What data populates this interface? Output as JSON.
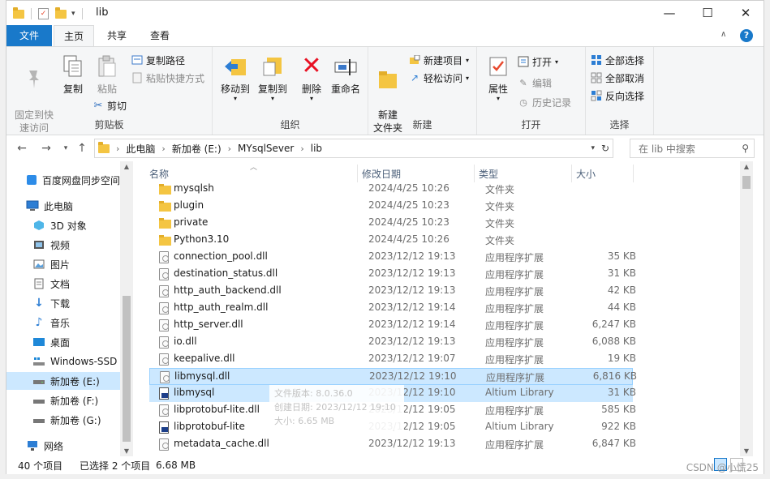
{
  "window": {
    "title": "lib",
    "minimize": "—",
    "maximize": "☐",
    "close": "✕",
    "help": "?"
  },
  "ribbon_tabs": [
    {
      "label": "文件"
    },
    {
      "label": "主页"
    },
    {
      "label": "共享"
    },
    {
      "label": "查看"
    }
  ],
  "ribbon": {
    "clipboard": {
      "label": "剪贴板",
      "pin": "固定到快\n速访问",
      "copy": "复制",
      "paste": "粘贴",
      "copy_path": "复制路径",
      "paste_shortcut": "粘贴快捷方式",
      "cut": "剪切"
    },
    "organize": {
      "label": "组织",
      "move_to": "移动到",
      "copy_to": "复制到",
      "delete": "删除",
      "rename": "重命名"
    },
    "new": {
      "label": "新建",
      "new_folder": "新建\n文件夹",
      "new_item": "新建项目",
      "easy_access": "轻松访问"
    },
    "open": {
      "label": "打开",
      "properties": "属性",
      "open": "打开",
      "edit": "编辑",
      "history": "历史记录"
    },
    "select": {
      "label": "选择",
      "select_all": "全部选择",
      "select_none": "全部取消",
      "invert": "反向选择"
    }
  },
  "address": {
    "crumbs": [
      "此电脑",
      "新加卷 (E:)",
      "MYsqlSever",
      "lib"
    ],
    "search_placeholder": "在 lib 中搜索"
  },
  "nav_items": [
    {
      "label": "百度网盘同步空间"
    },
    {
      "label": "此电脑"
    },
    {
      "label": "3D 对象"
    },
    {
      "label": "视频"
    },
    {
      "label": "图片"
    },
    {
      "label": "文档"
    },
    {
      "label": "下载"
    },
    {
      "label": "音乐"
    },
    {
      "label": "桌面"
    },
    {
      "label": "Windows-SSD"
    },
    {
      "label": "新加卷 (E:)"
    },
    {
      "label": "新加卷 (F:)"
    },
    {
      "label": "新加卷 (G:)"
    },
    {
      "label": "网络"
    }
  ],
  "columns": {
    "name": "名称",
    "date": "修改日期",
    "type": "类型",
    "size": "大小"
  },
  "files": [
    {
      "name": "mysqlsh",
      "date": "2024/4/25 10:26",
      "type": "文件夹",
      "size": "",
      "kind": "folder"
    },
    {
      "name": "plugin",
      "date": "2024/4/25 10:23",
      "type": "文件夹",
      "size": "",
      "kind": "folder"
    },
    {
      "name": "private",
      "date": "2024/4/25 10:23",
      "type": "文件夹",
      "size": "",
      "kind": "folder"
    },
    {
      "name": "Python3.10",
      "date": "2024/4/25 10:26",
      "type": "文件夹",
      "size": "",
      "kind": "folder"
    },
    {
      "name": "connection_pool.dll",
      "date": "2023/12/12 19:13",
      "type": "应用程序扩展",
      "size": "35 KB",
      "kind": "dll"
    },
    {
      "name": "destination_status.dll",
      "date": "2023/12/12 19:13",
      "type": "应用程序扩展",
      "size": "31 KB",
      "kind": "dll"
    },
    {
      "name": "http_auth_backend.dll",
      "date": "2023/12/12 19:13",
      "type": "应用程序扩展",
      "size": "42 KB",
      "kind": "dll"
    },
    {
      "name": "http_auth_realm.dll",
      "date": "2023/12/12 19:14",
      "type": "应用程序扩展",
      "size": "44 KB",
      "kind": "dll"
    },
    {
      "name": "http_server.dll",
      "date": "2023/12/12 19:14",
      "type": "应用程序扩展",
      "size": "6,247 KB",
      "kind": "dll"
    },
    {
      "name": "io.dll",
      "date": "2023/12/12 19:13",
      "type": "应用程序扩展",
      "size": "6,088 KB",
      "kind": "dll"
    },
    {
      "name": "keepalive.dll",
      "date": "2023/12/12 19:07",
      "type": "应用程序扩展",
      "size": "19 KB",
      "kind": "dll"
    },
    {
      "name": "libmysql.dll",
      "date": "2023/12/12 19:10",
      "type": "应用程序扩展",
      "size": "6,816 KB",
      "kind": "dll",
      "selected": "focus"
    },
    {
      "name": "libmysql",
      "date": "2023/12/12 19:10",
      "type": "Altium Library",
      "size": "31 KB",
      "kind": "alt",
      "selected": "yes"
    },
    {
      "name": "libprotobuf-lite.dll",
      "date": "2023/12/12 19:05",
      "type": "应用程序扩展",
      "size": "585 KB",
      "kind": "dll"
    },
    {
      "name": "libprotobuf-lite",
      "date": "2023/12/12 19:05",
      "type": "Altium Library",
      "size": "922 KB",
      "kind": "alt"
    },
    {
      "name": "metadata_cache.dll",
      "date": "2023/12/12 19:13",
      "type": "应用程序扩展",
      "size": "6,847 KB",
      "kind": "dll"
    }
  ],
  "tooltip": {
    "line1": "文件版本: 8.0.36.0",
    "line2": "创建日期: 2023/12/12 19:10",
    "line3": "大小: 6.65 MB"
  },
  "status": {
    "count": "40 个项目",
    "selected": "已选择 2 个项目",
    "size": "6.68 MB"
  },
  "watermark": "CSDN @小慌25",
  "colors": {
    "accent": "#1979ca",
    "selection": "#cce8ff",
    "folder": "#f4c542",
    "delete_red": "#e81123"
  }
}
